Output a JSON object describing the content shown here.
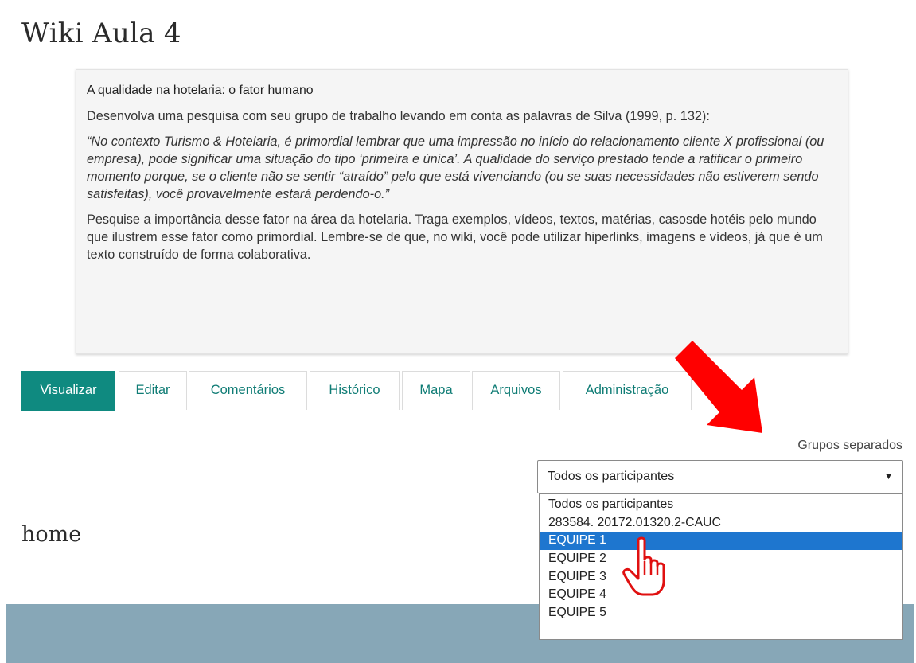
{
  "page": {
    "title": "Wiki Aula 4"
  },
  "intro": {
    "heading": "A qualidade na hotelaria: o fator humano",
    "paragraph1": "Desenvolva uma pesquisa com seu grupo de trabalho levando em conta as palavras de Silva (1999, p. 132):",
    "quote": "“No contexto Turismo & Hotelaria, é primordial lembrar que uma impressão no início do relacionamento cliente X profissional (ou empresa), pode significar uma situação do tipo ‘primeira e única’. A qualidade do serviço prestado tende a ratificar o primeiro momento porque, se o cliente não se sentir “atraído” pelo que está vivenciando (ou se suas necessidades não estiverem sendo satisfeitas), você provavelmente estará perdendo-o.”",
    "paragraph2": "Pesquise a importância desse fator na área da hotelaria. Traga exemplos, vídeos, textos, matérias, casosde hotéis pelo mundo que ilustrem esse fator como primordial. Lembre-se de que, no wiki, você pode utilizar hiperlinks, imagens e vídeos, já que é um texto construído de forma colaborativa."
  },
  "tabs": [
    {
      "label": "Visualizar",
      "active": true
    },
    {
      "label": "Editar",
      "active": false
    },
    {
      "label": "Comentários",
      "active": false
    },
    {
      "label": "Histórico",
      "active": false
    },
    {
      "label": "Mapa",
      "active": false
    },
    {
      "label": "Arquivos",
      "active": false
    },
    {
      "label": "Administração",
      "active": false
    }
  ],
  "groups": {
    "label": "Grupos separados",
    "selected_value": "Todos os participantes",
    "options": [
      {
        "label": "Todos os participantes",
        "highlighted": false
      },
      {
        "label": "283584. 20172.01320.2-CAUC",
        "highlighted": false
      },
      {
        "label": "EQUIPE 1",
        "highlighted": true
      },
      {
        "label": "EQUIPE 2",
        "highlighted": false
      },
      {
        "label": "EQUIPE 3",
        "highlighted": false
      },
      {
        "label": "EQUIPE 4",
        "highlighted": false
      },
      {
        "label": "EQUIPE 5",
        "highlighted": false
      }
    ]
  },
  "content": {
    "page_name": "home"
  },
  "icons": {
    "select_caret": "▼",
    "annotation_arrow": "red-arrow-icon",
    "pointer": "hand-pointer-icon"
  },
  "colors": {
    "accent": "#0f8a80",
    "tab_text": "#0f7c75",
    "highlight": "#1e76cf",
    "footer": "#87a7b7",
    "annotation": "#ff0000"
  }
}
